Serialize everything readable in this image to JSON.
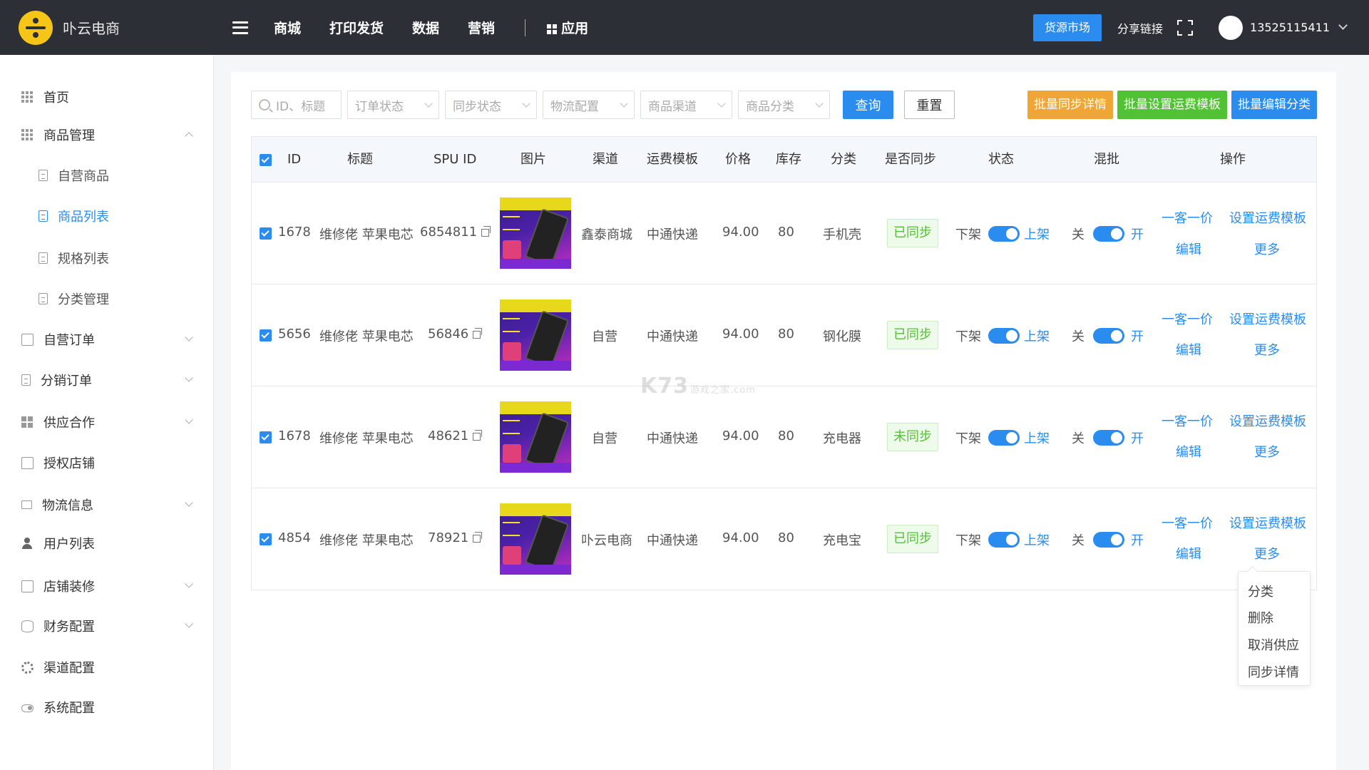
{
  "app": {
    "name": "卟云电商"
  },
  "topnav": {
    "items": [
      "商城",
      "打印发货",
      "数据",
      "营销"
    ],
    "apps_label": "应用"
  },
  "header": {
    "market_button": "货源市场",
    "share_link": "分享链接",
    "user_phone": "13525115411"
  },
  "sidebar": {
    "items": [
      {
        "label": "首页",
        "icon": "grid-icon"
      },
      {
        "label": "商品管理",
        "icon": "grid-icon",
        "expanded": true
      },
      {
        "label": "自营商品",
        "icon": "document-icon",
        "sub": true
      },
      {
        "label": "商品列表",
        "icon": "document-icon",
        "sub": true,
        "active": true
      },
      {
        "label": "规格列表",
        "icon": "document-icon",
        "sub": true
      },
      {
        "label": "分类管理",
        "icon": "document-icon",
        "sub": true
      },
      {
        "label": "自营订单",
        "icon": "square-icon"
      },
      {
        "label": "分销订单",
        "icon": "document-icon"
      },
      {
        "label": "供应合作",
        "icon": "apps-icon"
      },
      {
        "label": "授权店铺",
        "icon": "store-icon"
      },
      {
        "label": "物流信息",
        "icon": "truck-icon"
      },
      {
        "label": "用户列表",
        "icon": "user-icon"
      },
      {
        "label": "店铺装修",
        "icon": "shop-icon"
      },
      {
        "label": "财务配置",
        "icon": "database-icon"
      },
      {
        "label": "渠道配置",
        "icon": "gear-icon"
      },
      {
        "label": "系统配置",
        "icon": "toggle-icon"
      }
    ]
  },
  "filters": {
    "search_placeholder": "ID、标题",
    "selects": [
      "订单状态",
      "同步状态",
      "物流配置",
      "商品渠道",
      "商品分类"
    ],
    "query_button": "查询",
    "reset_button": "重置"
  },
  "batch": {
    "sync_detail": "批量同步详情",
    "set_shipping": "批量设置运费模板",
    "edit_category": "批量编辑分类"
  },
  "table": {
    "headers": [
      "ID",
      "标题",
      "SPU ID",
      "图片",
      "渠道",
      "运费模板",
      "价格",
      "库存",
      "分类",
      "是否同步",
      "状态",
      "混批",
      "操作"
    ],
    "rows": [
      {
        "id": "1678",
        "title": "维修佬 苹果电芯",
        "spu": "6854811",
        "channel": "鑫泰商城",
        "shipping": "中通快递",
        "price": "94.00",
        "stock": "80",
        "category": "手机壳",
        "sync": "已同步",
        "status_off": "下架",
        "status_on": "上架",
        "mix_off": "关",
        "mix_on": "开"
      },
      {
        "id": "5656",
        "title": "维修佬 苹果电芯",
        "spu": "56846",
        "channel": "自营",
        "shipping": "中通快递",
        "price": "94.00",
        "stock": "80",
        "category": "钢化膜",
        "sync": "已同步",
        "status_off": "下架",
        "status_on": "上架",
        "mix_off": "关",
        "mix_on": "开"
      },
      {
        "id": "1678",
        "title": "维修佬 苹果电芯",
        "spu": "48621",
        "channel": "自营",
        "shipping": "中通快递",
        "price": "94.00",
        "stock": "80",
        "category": "充电器",
        "sync": "未同步",
        "status_off": "下架",
        "status_on": "上架",
        "mix_off": "关",
        "mix_on": "开"
      },
      {
        "id": "4854",
        "title": "维修佬 苹果电芯",
        "spu": "78921",
        "channel": "卟云电商",
        "shipping": "中通快递",
        "price": "94.00",
        "stock": "80",
        "category": "充电宝",
        "sync": "已同步",
        "status_off": "下架",
        "status_on": "上架",
        "mix_off": "关",
        "mix_on": "开"
      }
    ],
    "actions": {
      "one_price": "一客一价",
      "set_shipping": "设置运费模板",
      "edit": "编辑",
      "more": "更多"
    }
  },
  "more_menu": [
    "分类",
    "删除",
    "取消供应",
    "同步详情"
  ],
  "watermark": {
    "main": "K73",
    "sub": "游戏之家.com"
  },
  "colors": {
    "primary": "#2b8cf0",
    "orange": "#f0a537",
    "green": "#52c235",
    "topbar": "#2c2f36"
  }
}
